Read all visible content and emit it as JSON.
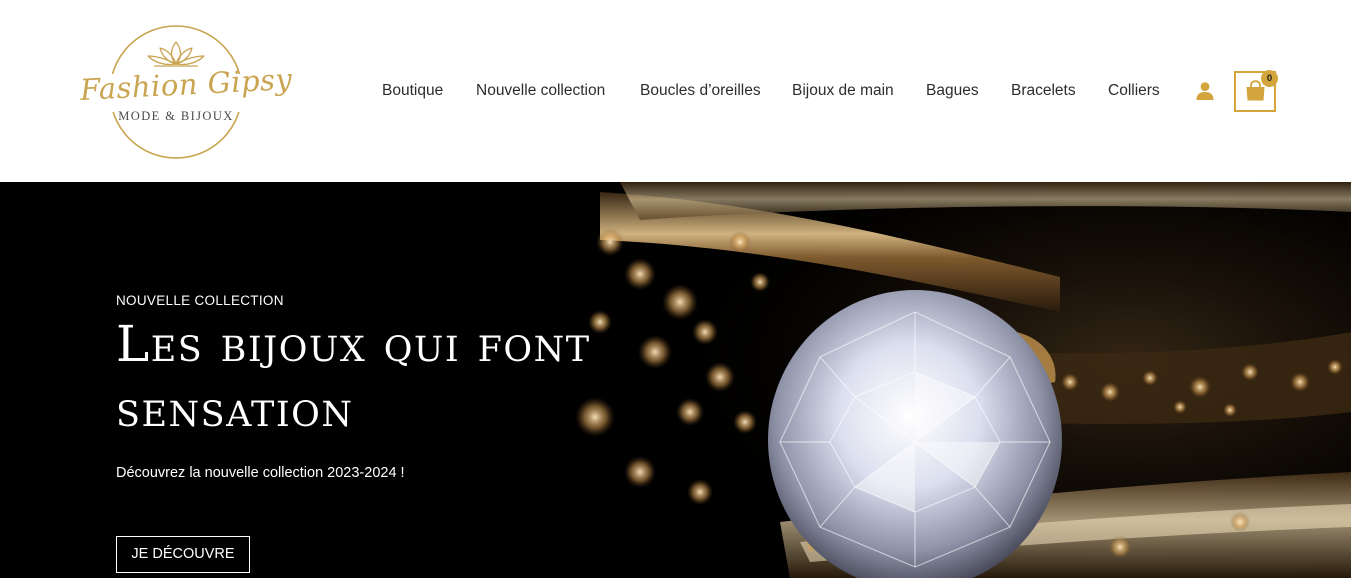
{
  "brand": {
    "script": "Fashion Gipsy",
    "tagline": "MODE & BIJOUX"
  },
  "nav": {
    "items": [
      {
        "label": "Boutique"
      },
      {
        "label": "Nouvelle collection"
      },
      {
        "label": "Boucles d’oreilles"
      },
      {
        "label": "Bijoux de main"
      },
      {
        "label": "Bagues"
      },
      {
        "label": "Bracelets"
      },
      {
        "label": "Colliers"
      }
    ],
    "account_icon": "user-icon",
    "cart_icon": "shopping-bag-icon",
    "cart_count": "0"
  },
  "hero": {
    "eyebrow": "NOUVELLE COLLECTION",
    "title": "Les bijoux qui font sensation",
    "subtitle": "Découvrez la nouvelle collection 2023-2024 !",
    "cta_label": "JE DÉCOUVRE"
  },
  "colors": {
    "accent_gold": "#d4a53c",
    "logo_gold": "#c9a451",
    "nav_text": "#2d2d2d",
    "hero_background": "#000000",
    "hero_text": "#ffffff"
  }
}
